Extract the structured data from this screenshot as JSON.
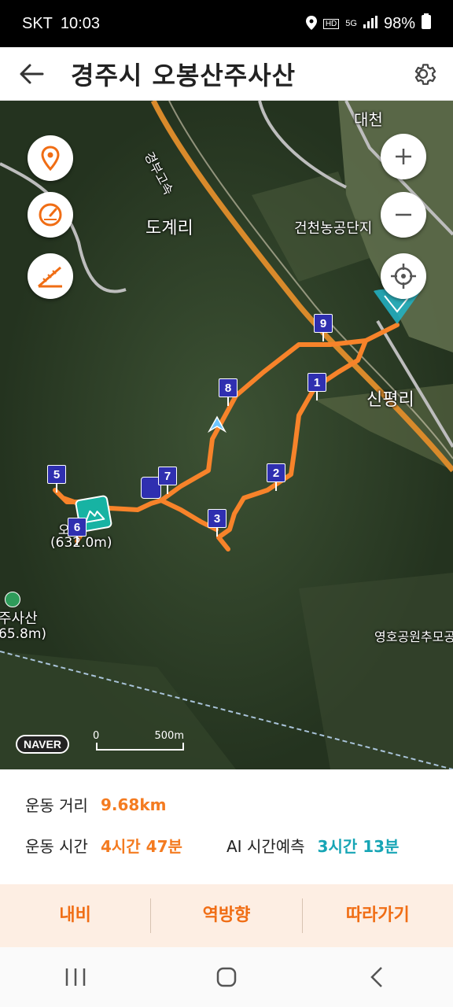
{
  "status_bar": {
    "carrier": "SKT",
    "time": "10:03",
    "battery": "98%"
  },
  "header": {
    "title": "경주시 오봉산주사산"
  },
  "map": {
    "labels": {
      "daecheon": "대천",
      "gyeongbu": "경부고속",
      "dogye": "도계리",
      "geoncheon": "건천농공단지",
      "sinpyeong": "신평리",
      "obong_name": "오",
      "obong_height": "(632.0m)",
      "jusa_name": "주사산",
      "jusa_height": "65.8m)",
      "yeongho": "영호공원추모공"
    },
    "markers": [
      "1",
      "2",
      "3",
      "5",
      "6",
      "7",
      "8",
      "9"
    ],
    "naver": "NAVER",
    "scale_zero": "0",
    "scale_dist": "500m"
  },
  "info": {
    "distance_label": "운동 거리",
    "distance_value": "9.68km",
    "time_label": "운동 시간",
    "time_value": "4시간 47분",
    "ai_label": "AI 시간예측",
    "ai_value": "3시간 13분"
  },
  "actions": {
    "navi": "내비",
    "reverse": "역방향",
    "follow": "따라가기"
  },
  "colors": {
    "accent": "#f47b20",
    "teal": "#17a5b5",
    "route": "#f7832a",
    "marker": "#2f2fb0"
  }
}
